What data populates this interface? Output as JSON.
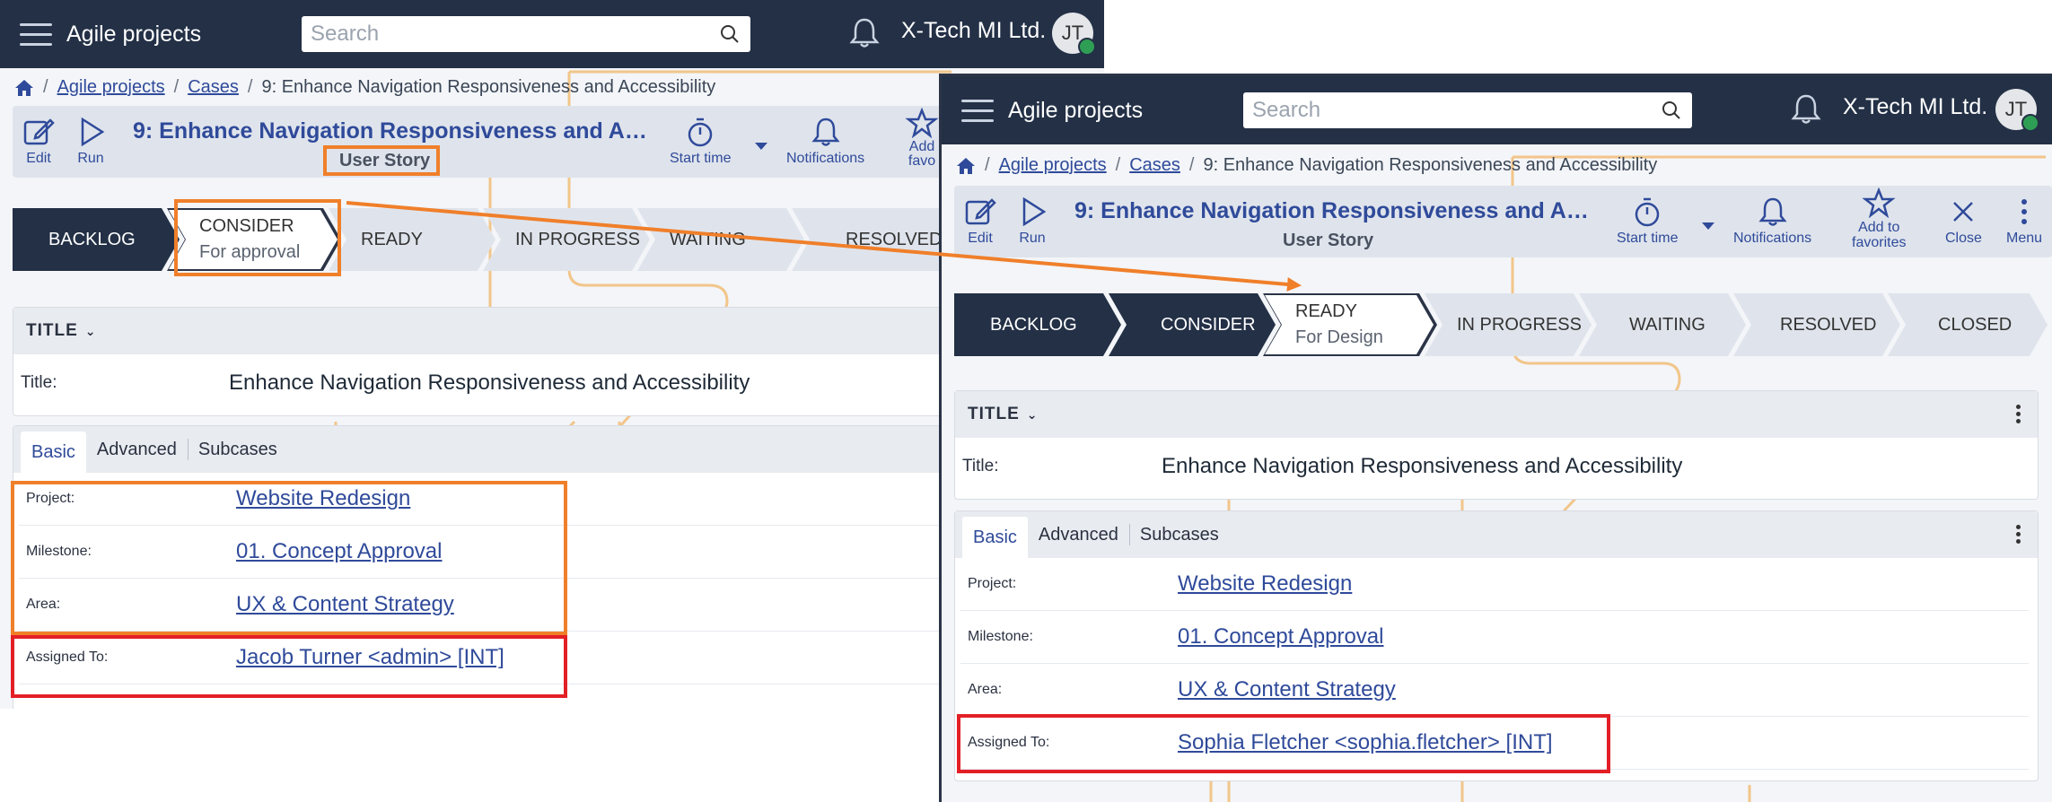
{
  "app": {
    "title": "Agile projects",
    "search_placeholder": "Search",
    "org": "X-Tech MI Ltd.",
    "avatar_initials": "JT"
  },
  "breadcrumb": {
    "items": [
      "Agile projects",
      "Cases"
    ],
    "current": "9: Enhance Navigation Responsiveness and Accessibility"
  },
  "case": {
    "title": "9: Enhance Navigation Responsiveness and A…",
    "type": "User Story"
  },
  "toolbar": {
    "edit": "Edit",
    "run": "Run",
    "start_time": "Start time",
    "notifications": "Notifications",
    "add_to_favorites": "Add to favorites",
    "add_fav_line1": "Add to",
    "add_fav_line2": "favorites",
    "add_fav_cut_line1": "Add",
    "add_fav_cut_line2": "favo",
    "close": "Close",
    "menu": "Menu"
  },
  "stages_left": [
    {
      "label": "BACKLOG",
      "state": "done"
    },
    {
      "label": "CONSIDER",
      "sub": "For approval",
      "state": "current"
    },
    {
      "label": "READY",
      "state": "todo"
    },
    {
      "label": "IN PROGRESS",
      "state": "todo"
    },
    {
      "label": "WAITING",
      "state": "todo"
    },
    {
      "label": "RESOLVED",
      "state": "todo"
    }
  ],
  "stages_right": [
    {
      "label": "BACKLOG",
      "state": "done"
    },
    {
      "label": "CONSIDER",
      "state": "done"
    },
    {
      "label": "READY",
      "sub": "For Design",
      "state": "current"
    },
    {
      "label": "IN PROGRESS",
      "state": "todo"
    },
    {
      "label": "WAITING",
      "state": "todo"
    },
    {
      "label": "RESOLVED",
      "state": "todo"
    },
    {
      "label": "CLOSED",
      "state": "todo"
    }
  ],
  "title_section": {
    "heading": "TITLE",
    "label": "Title:",
    "value": "Enhance Navigation Responsiveness and Accessibility"
  },
  "tabs": [
    "Basic",
    "Advanced",
    "Subcases"
  ],
  "fields": {
    "project_label": "Project:",
    "project": "Website Redesign",
    "milestone_label": "Milestone:",
    "milestone": "01. Concept Approval",
    "area_label": "Area:",
    "area": "UX & Content Strategy",
    "assigned_label": "Assigned To:",
    "assigned_left": "Jacob Turner <admin> [INT]",
    "assigned_right": "Sophia Fletcher <sophia.fletcher> [INT]"
  },
  "colors": {
    "topbar": "#233046",
    "accent": "#2f4a9a",
    "highlight_orange": "#f07f2a",
    "highlight_red": "#e31f26"
  }
}
